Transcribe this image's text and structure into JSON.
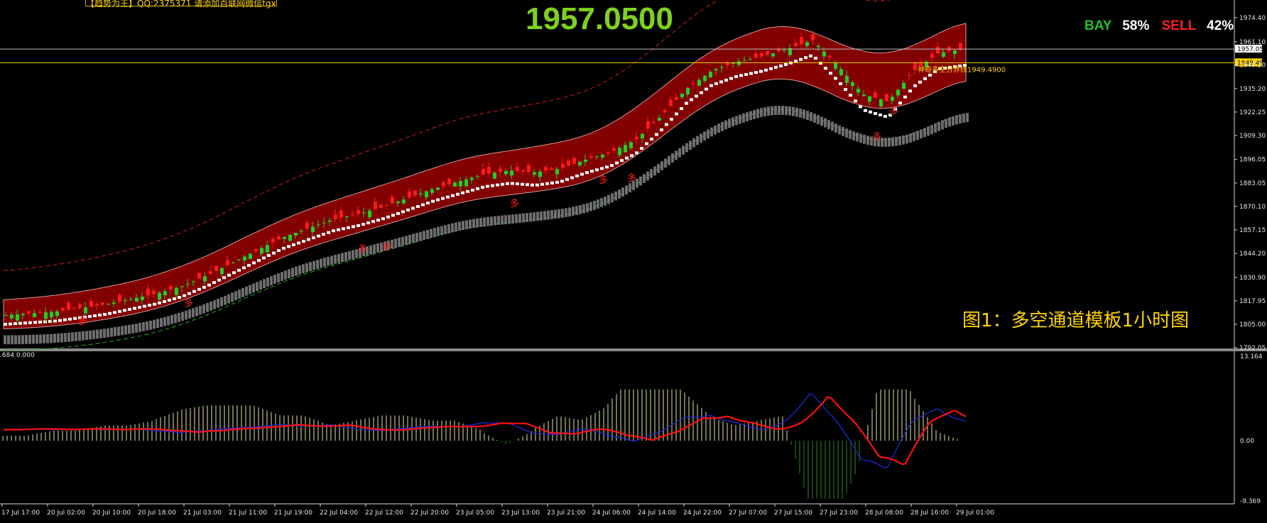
{
  "top_banner": "【趋势为王】QQ:2375371 请添加百联网微信tgx",
  "current_price": "1957.0500",
  "sentiment": {
    "buy_label": "BAY",
    "buy_pct": "58%",
    "sell_label": "SELL",
    "sell_pct": "42%",
    "buy_color": "#22c02a",
    "sell_color": "#ff2020"
  },
  "price_tags": {
    "current": "1957.05",
    "line": "1949.49"
  },
  "line_note": "神奇多空分界线1949.4900",
  "caption": "图1：多空通道模板1小时图",
  "signal_glyph": "多",
  "sub_header": ".684 0.000",
  "chart_data": [
    {
      "type": "candlestick",
      "title": "",
      "y_axis": {
        "ticks": [
          "1974.40",
          "1961.10",
          "1948.20",
          "1935.20",
          "1922.25",
          "1909.30",
          "1896.05",
          "1883.05",
          "1870.10",
          "1857.15",
          "1844.20",
          "1830.90",
          "1817.95",
          "1805.00",
          "1792.05"
        ],
        "range": [
          1792.05,
          1981.0
        ]
      },
      "x_axis": {
        "ticks": [
          "17 Jul 17:00",
          "20 Jul 02:00",
          "20 Jul 10:00",
          "20 Jul 18:00",
          "21 Jul 03:00",
          "21 Jul 11:00",
          "21 Jul 19:00",
          "22 Jul 04:00",
          "22 Jul 12:00",
          "22 Jul 20:00",
          "23 Jul 05:00",
          "23 Jul 13:00",
          "23 Jul 21:00",
          "24 Jul 06:00",
          "24 Jul 14:00",
          "24 Jul 22:00",
          "27 Jul 07:00",
          "27 Jul 15:00",
          "27 Jul 23:00",
          "28 Jul 08:00",
          "28 Jul 16:00",
          "29 Jul 01:00"
        ]
      },
      "horizontal_lines": [
        1957.05,
        1949.49
      ],
      "colors": {
        "up": "#1fd11f",
        "down": "#ff1a1a",
        "channel_fill": "#8b0000",
        "support": "#ffffff",
        "gray_band": "#808080",
        "resist_dash": "#c81e1e",
        "green_dash": "#22b022"
      },
      "approx_close_path": [
        1810,
        1811,
        1812,
        1814,
        1816,
        1819,
        1822,
        1826,
        1832,
        1839,
        1846,
        1853,
        1858,
        1863,
        1866,
        1870,
        1875,
        1880,
        1884,
        1888,
        1890,
        1889,
        1891,
        1896,
        1900,
        1907,
        1920,
        1935,
        1945,
        1950,
        1953,
        1957,
        1962,
        1948,
        1932,
        1928,
        1945,
        1955,
        1957
      ]
    },
    {
      "type": "macd",
      "y_axis": {
        "ticks": [
          "13.164",
          "0.00",
          "-9.369"
        ],
        "range": [
          -9.369,
          13.164
        ]
      }
    }
  ]
}
